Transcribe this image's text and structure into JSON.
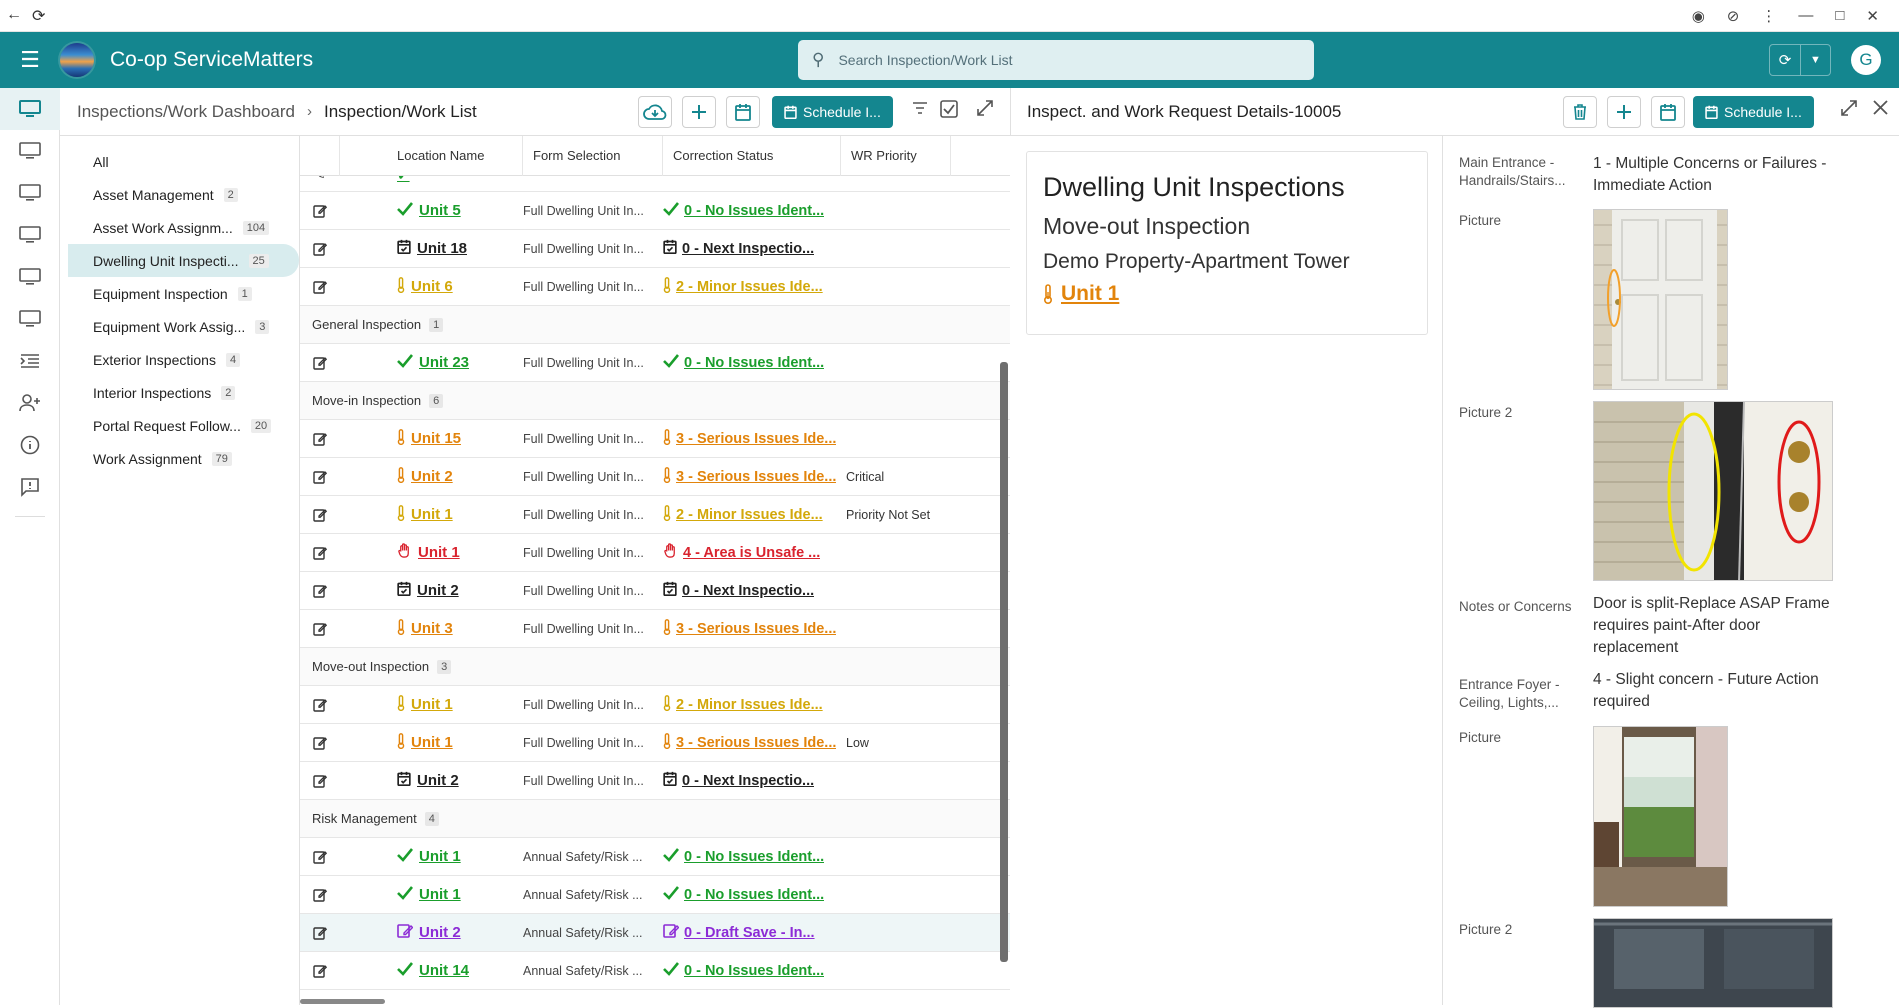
{
  "app": {
    "title": "Co-op ServiceMatters",
    "search_placeholder": "Search Inspection/Work List",
    "avatar": "G"
  },
  "breadcrumb": {
    "parent": "Inspections/Work Dashboard",
    "current": "Inspection/Work List"
  },
  "toolbar": {
    "schedule_label": "Schedule I..."
  },
  "categories": [
    {
      "label": "All",
      "count": ""
    },
    {
      "label": "Asset Management",
      "count": "2"
    },
    {
      "label": "Asset Work Assignm...",
      "count": "104"
    },
    {
      "label": "Dwelling Unit Inspecti...",
      "count": "25"
    },
    {
      "label": "Equipment Inspection",
      "count": "1"
    },
    {
      "label": "Equipment Work Assig...",
      "count": "3"
    },
    {
      "label": "Exterior Inspections",
      "count": "4"
    },
    {
      "label": "Interior Inspections",
      "count": "2"
    },
    {
      "label": "Portal Request Follow...",
      "count": "20"
    },
    {
      "label": "Work Assignment",
      "count": "79"
    }
  ],
  "grid": {
    "columns": [
      "Location Name",
      "Form Selection",
      "Correction Status",
      "WR Priority"
    ],
    "rows": [
      {
        "type": "row",
        "icon": "check",
        "color": "green",
        "unit": "Unit 5",
        "form": "Full Dwelling Unit In...",
        "status": "0 - No Issues Ident...",
        "priority": ""
      },
      {
        "type": "row",
        "icon": "calendar",
        "color": "black",
        "unit": "Unit 18",
        "form": "Full Dwelling Unit In...",
        "status": "0 - Next Inspectio...",
        "priority": ""
      },
      {
        "type": "row",
        "icon": "thermo",
        "color": "gold",
        "unit": "Unit 6",
        "form": "Full Dwelling Unit In...",
        "status": "2 - Minor Issues Ide...",
        "priority": ""
      },
      {
        "type": "group",
        "label": "General Inspection",
        "count": "1"
      },
      {
        "type": "row",
        "icon": "check",
        "color": "green",
        "unit": "Unit 23",
        "form": "Full Dwelling Unit In...",
        "status": "0 - No Issues Ident...",
        "priority": ""
      },
      {
        "type": "group",
        "label": "Move-in Inspection",
        "count": "6"
      },
      {
        "type": "row",
        "icon": "thermo",
        "color": "orange",
        "unit": "Unit 15",
        "form": "Full Dwelling Unit In...",
        "status": "3 - Serious Issues Ide...",
        "priority": ""
      },
      {
        "type": "row",
        "icon": "thermo",
        "color": "orange",
        "unit": "Unit 2",
        "form": "Full Dwelling Unit In...",
        "status": "3 - Serious Issues Ide...",
        "priority": "Critical"
      },
      {
        "type": "row",
        "icon": "thermo",
        "color": "gold",
        "unit": "Unit 1",
        "form": "Full Dwelling Unit In...",
        "status": "2 - Minor Issues Ide...",
        "priority": "Priority Not Set"
      },
      {
        "type": "row",
        "icon": "hand",
        "color": "red",
        "unit": "Unit 1",
        "form": "Full Dwelling Unit In...",
        "status": "4 - Area is Unsafe ...",
        "priority": ""
      },
      {
        "type": "row",
        "icon": "calendar",
        "color": "black",
        "unit": "Unit 2",
        "form": "Full Dwelling Unit In...",
        "status": "0 - Next Inspectio...",
        "priority": ""
      },
      {
        "type": "row",
        "icon": "thermo",
        "color": "orange",
        "unit": "Unit 3",
        "form": "Full Dwelling Unit In...",
        "status": "3 - Serious Issues Ide...",
        "priority": ""
      },
      {
        "type": "group",
        "label": "Move-out Inspection",
        "count": "3"
      },
      {
        "type": "row",
        "icon": "thermo",
        "color": "gold",
        "unit": "Unit 1",
        "form": "Full Dwelling Unit In...",
        "status": "2 - Minor Issues Ide...",
        "priority": ""
      },
      {
        "type": "row",
        "icon": "thermo",
        "color": "orange",
        "unit": "Unit 1",
        "form": "Full Dwelling Unit In...",
        "status": "3 - Serious Issues Ide...",
        "priority": "Low"
      },
      {
        "type": "row",
        "icon": "calendar",
        "color": "black",
        "unit": "Unit 2",
        "form": "Full Dwelling Unit In...",
        "status": "0 - Next Inspectio...",
        "priority": ""
      },
      {
        "type": "group",
        "label": "Risk Management",
        "count": "4"
      },
      {
        "type": "row",
        "icon": "check",
        "color": "green",
        "unit": "Unit 1",
        "form": "Annual Safety/Risk ...",
        "status": "0 - No Issues Ident...",
        "priority": ""
      },
      {
        "type": "row",
        "icon": "check",
        "color": "green",
        "unit": "Unit 1",
        "form": "Annual Safety/Risk ...",
        "status": "0 - No Issues Ident...",
        "priority": ""
      },
      {
        "type": "row",
        "icon": "draft",
        "color": "purple",
        "unit": "Unit 2",
        "form": "Annual Safety/Risk ...",
        "status": "0 - Draft Save - In...",
        "priority": "",
        "selected": true
      },
      {
        "type": "row",
        "icon": "check",
        "color": "green",
        "unit": "Unit 14",
        "form": "Annual Safety/Risk ...",
        "status": "0 - No Issues Ident...",
        "priority": ""
      }
    ]
  },
  "detail": {
    "title": "Inspect. and Work Request Details-10005",
    "schedule_label": "Schedule I...",
    "card": {
      "heading": "Dwelling Unit Inspections",
      "subheading": "Move-out Inspection",
      "property": "Demo Property-Apartment Tower",
      "unit": "Unit 1"
    },
    "fields": {
      "f1_label": "Main Entrance - Handrails/Stairs...",
      "f1_value": "1 - Multiple Concerns or Failures - Immediate Action",
      "pic1_label": "Picture",
      "pic2_label": "Picture 2",
      "notes_label": "Notes or Concerns",
      "notes_value": "Door is split-Replace ASAP Frame requires paint-After door replacement",
      "f2_label": "Entrance Foyer - Ceiling, Lights,...",
      "f2_value": "4 - Slight concern - Future Action required",
      "pic3_label": "Picture",
      "pic4_label": "Picture 2"
    }
  },
  "colors": {
    "brand": "#14868f",
    "green": "#1a9e2c",
    "gold": "#d3a80a",
    "orange": "#e2840c",
    "red": "#d9232e",
    "purple": "#8c2bd6"
  }
}
